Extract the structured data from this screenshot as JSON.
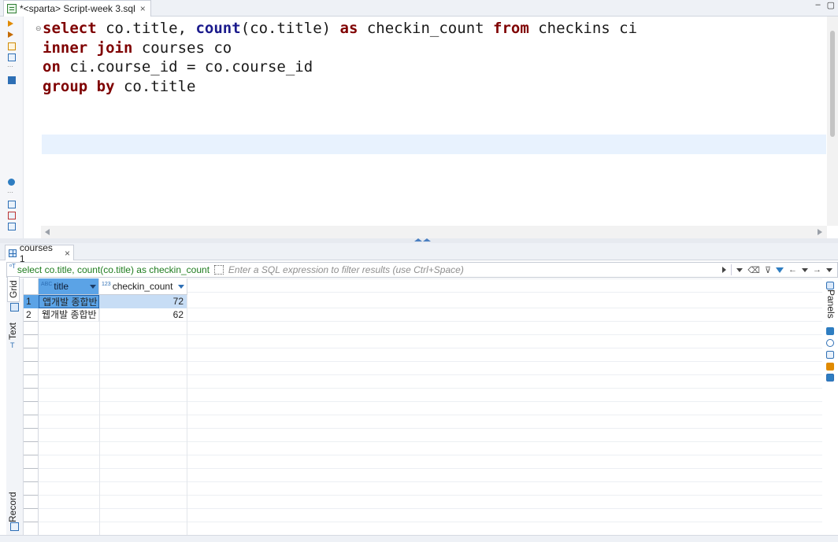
{
  "editor_tab": {
    "title": "*<sparta> Script-week 3.sql",
    "close": "×"
  },
  "window_controls": {
    "minimize": "–",
    "maximize": "▢"
  },
  "sql": {
    "lines": [
      [
        {
          "t": "select",
          "c": "kw"
        },
        {
          "t": " co.title, ",
          "c": ""
        },
        {
          "t": "count",
          "c": "fn"
        },
        {
          "t": "(co.title) ",
          "c": ""
        },
        {
          "t": "as",
          "c": "kw"
        },
        {
          "t": " checkin_count ",
          "c": ""
        },
        {
          "t": "from",
          "c": "kw"
        },
        {
          "t": " checkins ci",
          "c": ""
        }
      ],
      [
        {
          "t": "inner",
          "c": "kw"
        },
        {
          "t": " ",
          "c": ""
        },
        {
          "t": "join",
          "c": "kw"
        },
        {
          "t": " courses co",
          "c": ""
        }
      ],
      [
        {
          "t": "on",
          "c": "kw"
        },
        {
          "t": " ci.course_id = co.course_id",
          "c": ""
        }
      ],
      [
        {
          "t": "group",
          "c": "kw"
        },
        {
          "t": " ",
          "c": ""
        },
        {
          "t": "by",
          "c": "kw"
        },
        {
          "t": " co.title",
          "c": ""
        }
      ]
    ]
  },
  "results": {
    "tab_label": "courses 1",
    "tab_close": "×",
    "query_text": "select co.title, count(co.title) as checkin_count",
    "filter_placeholder": "Enter a SQL expression to filter results (use Ctrl+Space)",
    "side_tabs": {
      "grid": "Grid",
      "text": "Text",
      "record": "Record"
    },
    "panels_label": "Panels",
    "columns": [
      {
        "name": "title",
        "type_icon": "ABC"
      },
      {
        "name": "checkin_count",
        "type_icon": "123"
      }
    ],
    "rows": [
      {
        "num": "1",
        "title": "앱개발 종합반",
        "checkin_count": "72"
      },
      {
        "num": "2",
        "title": "웹개발 종합반",
        "checkin_count": "62"
      }
    ]
  }
}
